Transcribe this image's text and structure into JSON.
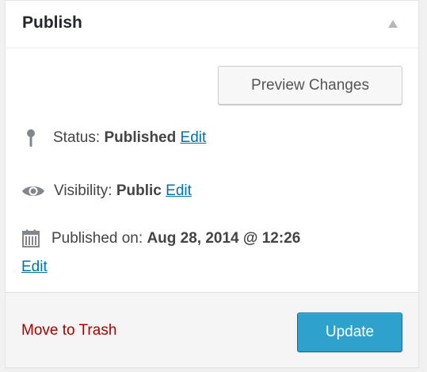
{
  "publish_box": {
    "title": "Publish",
    "toggle_icon": "triangle-up-icon",
    "preview_button_label": "Preview Changes",
    "status": {
      "icon": "pin-icon",
      "label": "Status:",
      "value": "Published",
      "edit_label": "Edit"
    },
    "visibility": {
      "icon": "eye-icon",
      "label": "Visibility:",
      "value": "Public",
      "edit_label": "Edit"
    },
    "published_on": {
      "icon": "calendar-icon",
      "label": "Published on:",
      "value": "Aug 28, 2014 @ 12:26",
      "edit_label": "Edit"
    },
    "trash_label": "Move to Trash",
    "update_button_label": "Update"
  },
  "colors": {
    "link": "#0073aa",
    "trash": "#aa0000",
    "primary_button": "#2ea2cc"
  }
}
